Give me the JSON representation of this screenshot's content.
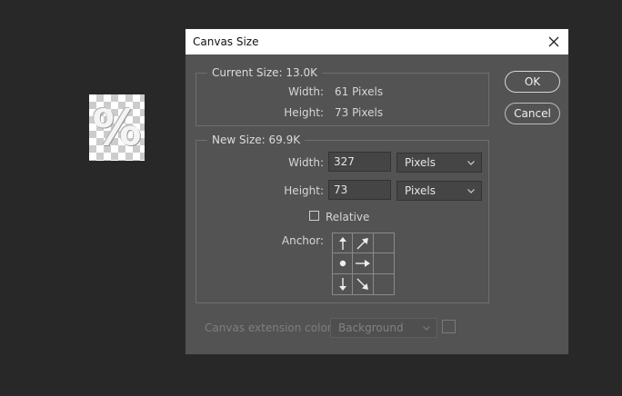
{
  "thumbnail": {
    "glyph": "%"
  },
  "dialog": {
    "title": "Canvas Size",
    "current_size": {
      "legend": "Current Size: 13.0K",
      "width_label": "Width:",
      "width_value": "61 Pixels",
      "height_label": "Height:",
      "height_value": "73 Pixels"
    },
    "new_size": {
      "legend": "New Size: 69.9K",
      "width_label": "Width:",
      "width_value": "327",
      "width_unit": "Pixels",
      "height_label": "Height:",
      "height_value": "73",
      "height_unit": "Pixels",
      "relative_label": "Relative",
      "relative_checked": false,
      "anchor_label": "Anchor:"
    },
    "extension": {
      "label": "Canvas extension color:",
      "value": "Background",
      "enabled": false
    },
    "buttons": {
      "ok": "OK",
      "cancel": "Cancel"
    }
  },
  "icons": {
    "close": "close-icon",
    "chevron": "chevron-down-icon",
    "anchor_arrows": [
      "arrow-up-icon",
      "arrow-up-right-icon",
      "",
      "anchor-dot-icon",
      "arrow-right-icon",
      "",
      "arrow-down-icon",
      "arrow-down-right-icon",
      ""
    ]
  },
  "colors": {
    "background": "#282828",
    "dialog": "#535353",
    "titlebar": "#ffffff",
    "input": "#454545"
  }
}
